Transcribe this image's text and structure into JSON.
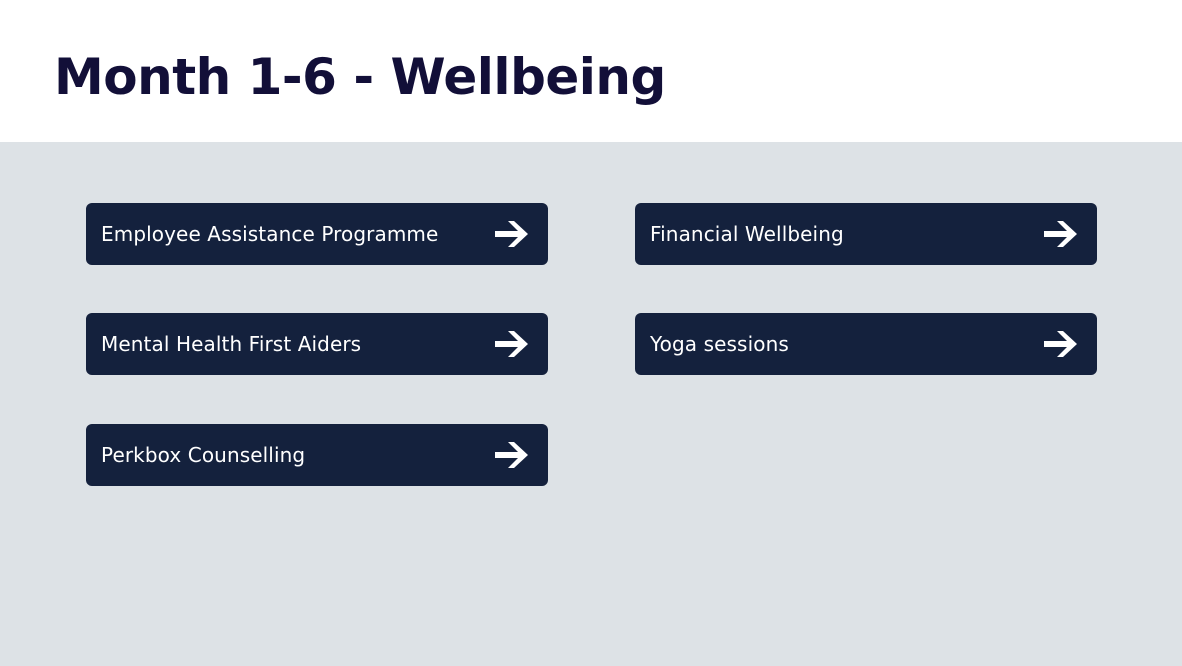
{
  "slide": {
    "title": "Month 1-6 - Wellbeing",
    "colors": {
      "title_text": "#120f38",
      "content_background": "#dde2e6",
      "card_background": "#14213d",
      "card_text": "#ffffff"
    }
  },
  "cards": [
    {
      "label": "Employee Assistance Programme",
      "icon": "arrow-right-icon"
    },
    {
      "label": "Financial Wellbeing",
      "icon": "arrow-right-icon"
    },
    {
      "label": "Mental Health First Aiders",
      "icon": "arrow-right-icon"
    },
    {
      "label": "Yoga sessions",
      "icon": "arrow-right-icon"
    },
    {
      "label": "Perkbox Counselling",
      "icon": "arrow-right-icon"
    }
  ]
}
